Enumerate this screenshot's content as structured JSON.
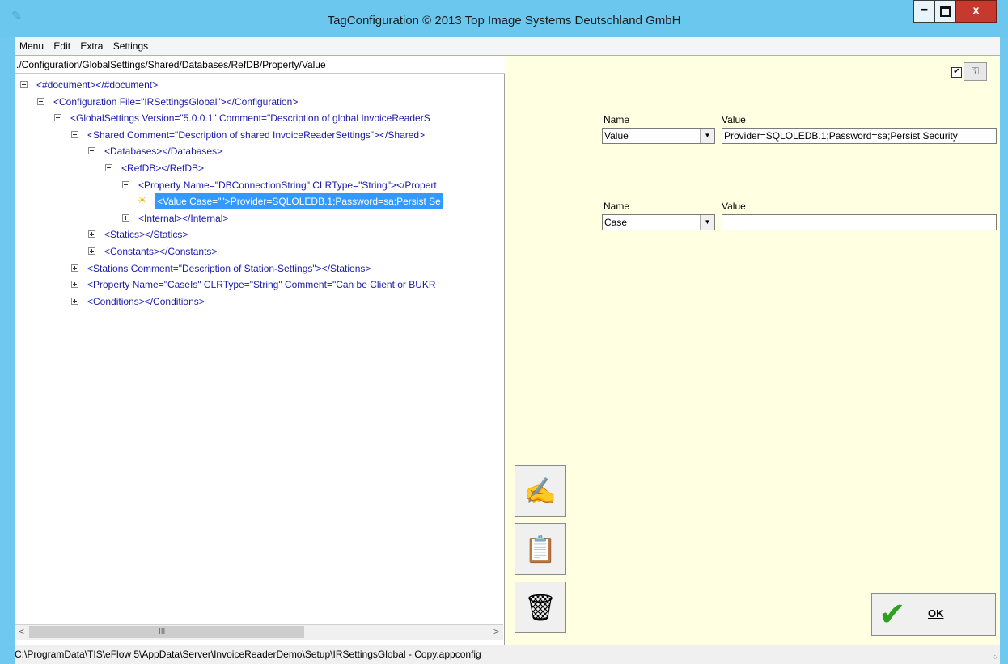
{
  "window": {
    "title": "TagConfiguration  © 2013 Top Image Systems Deutschland GmbH",
    "minimize_label": "–",
    "close_label": "x"
  },
  "menubar": [
    "Menu",
    "Edit",
    "Extra",
    "Settings"
  ],
  "path": "./Configuration/GlobalSettings/Shared/Databases/RefDB/Property/Value",
  "tree": [
    {
      "text": "<#document></#document>",
      "state": "minus"
    },
    {
      "text": "<Configuration File=\"IRSettingsGlobal\"></Configuration>",
      "state": "minus"
    },
    {
      "text": "<GlobalSettings Version=\"5.0.0.1\" Comment=\"Description of global InvoiceReaderS",
      "state": "minus"
    },
    {
      "text": "<Shared Comment=\"Description of shared InvoiceReaderSettings\"></Shared>",
      "state": "minus"
    },
    {
      "text": "<Databases></Databases>",
      "state": "minus"
    },
    {
      "text": "<RefDB></RefDB>",
      "state": "minus"
    },
    {
      "text": "<Property Name=\"DBConnectionString\" CLRType=\"String\"></Propert",
      "state": "minus"
    },
    {
      "text": "<Value Case=\"\">Provider=SQLOLEDB.1;Password=sa;Persist Se",
      "state": "leaf",
      "selected": true,
      "icon": "lightbulb-icon"
    },
    {
      "text": "<Internal></Internal>",
      "state": "plus"
    },
    {
      "text": "<Statics></Statics>",
      "state": "plus"
    },
    {
      "text": "<Constants></Constants>",
      "state": "plus"
    },
    {
      "text": "<Stations Comment=\"Description of Station-Settings\"></Stations>",
      "state": "plus"
    },
    {
      "text": "<Property Name=\"CaseIs\" CLRType=\"String\" Comment=\"Can be Client or BUKR",
      "state": "plus"
    },
    {
      "text": "<Conditions></Conditions>",
      "state": "plus"
    }
  ],
  "scroll": {
    "left_arrow": "<",
    "right_arrow": ">",
    "grip": "III"
  },
  "attributes": [
    {
      "name_label": "Name",
      "value_label": "Value",
      "name": "Value",
      "value": "Provider=SQLOLEDB.1;Password=sa;Persist Security"
    },
    {
      "name_label": "Name",
      "value_label": "Value",
      "name": "Case",
      "value": ""
    }
  ],
  "right_panel": {
    "checkbox_mark": "✔",
    "checkbox_checked": true,
    "key_icon": "key-icon"
  },
  "tool_buttons": [
    {
      "icon": "edit-document-icon",
      "glyph": "✍"
    },
    {
      "icon": "clipboard-icon",
      "glyph": "📋"
    },
    {
      "icon": "recycle-bin-icon",
      "glyph": "🗑"
    }
  ],
  "ok_button": {
    "label": "OK",
    "icon": "checkmark-icon"
  },
  "status": "C:\\ProgramData\\TIS\\eFlow 5\\AppData\\Server\\InvoiceReaderDemo\\Setup\\IRSettingsGlobal - Copy.appconfig"
}
